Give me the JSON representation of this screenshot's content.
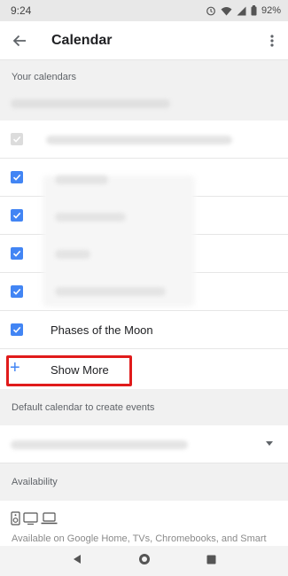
{
  "status_bar": {
    "time": "9:24",
    "battery": "92%"
  },
  "app_bar": {
    "title": "Calendar"
  },
  "sections": {
    "your_calendars": "Your calendars",
    "default_calendar": "Default calendar to create events",
    "availability": "Availability"
  },
  "calendars": [
    {
      "label": "",
      "checked": true,
      "disabled": true
    },
    {
      "label": "",
      "checked": true,
      "disabled": false
    },
    {
      "label": "",
      "checked": true,
      "disabled": false
    },
    {
      "label": "",
      "checked": true,
      "disabled": false
    },
    {
      "label": "",
      "checked": true,
      "disabled": false
    },
    {
      "label": "Phases of the Moon",
      "checked": true,
      "disabled": false
    }
  ],
  "show_more": {
    "label": "Show More"
  },
  "availability": {
    "devices_text": "Available on Google Home, TVs, Chromebooks, and Smart"
  },
  "colors": {
    "accent": "#4285f4",
    "highlight": "#e01b1b"
  }
}
